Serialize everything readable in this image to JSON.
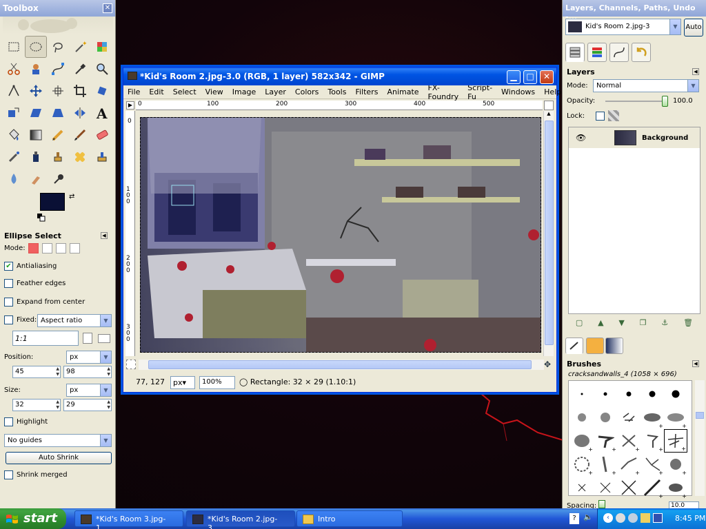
{
  "toolbox": {
    "title": "Toolbox",
    "tools": [
      "rect-select",
      "ellipse-select",
      "free-select",
      "fuzzy-select",
      "select-by-color",
      "scissors",
      "foreground-select",
      "paths",
      "color-picker",
      "zoom",
      "measure",
      "move",
      "align",
      "crop",
      "rotate",
      "scale",
      "shear",
      "perspective",
      "flip",
      "text",
      "bucket-fill",
      "blend",
      "pencil",
      "paintbrush",
      "eraser",
      "airbrush",
      "ink",
      "clone",
      "heal",
      "perspective-clone",
      "blur-sharpen",
      "smudge",
      "dodge-burn"
    ],
    "fg_color": "#0a1035",
    "bg_color": "#ffffff"
  },
  "tool_options": {
    "title": "Ellipse Select",
    "mode_label": "Mode:",
    "antialiasing_label": "Antialiasing",
    "feather_label": "Feather edges",
    "expand_label": "Expand from center",
    "fixed_label": "Fixed:",
    "fixed_value": "Aspect ratio",
    "ratio_value": "1:1",
    "position_label": "Position:",
    "position_unit": "px",
    "pos_x": "45",
    "pos_y": "98",
    "size_label": "Size:",
    "size_unit": "px",
    "size_w": "32",
    "size_h": "29",
    "highlight_label": "Highlight",
    "guides_value": "No guides",
    "autoshrink_label": "Auto Shrink",
    "shrink_merged_label": "Shrink merged"
  },
  "image_window": {
    "title": "*Kid's Room 2.jpg-3.0 (RGB, 1 layer) 582x342 - GIMP",
    "menus": [
      "File",
      "Edit",
      "Select",
      "View",
      "Image",
      "Layer",
      "Colors",
      "Tools",
      "Filters",
      "Animate",
      "FX-Foundry",
      "Script-Fu",
      "Windows",
      "Help"
    ],
    "ruler_top": [
      "0",
      "100",
      "200",
      "300",
      "400",
      "500"
    ],
    "ruler_left": [
      "0",
      "100",
      "200",
      "300"
    ],
    "coords": "77, 127",
    "unit": "px",
    "zoom": "100%",
    "status": "Rectangle: 32 × 29  (1.10:1)"
  },
  "layers_dock": {
    "title": "Layers, Channels, Paths, Undo -...",
    "image_select": "Kid's Room 2.jpg-3",
    "auto_label": "Auto",
    "panel_title": "Layers",
    "mode_label": "Mode:",
    "mode_value": "Normal",
    "opacity_label": "Opacity:",
    "opacity_value": "100.0",
    "lock_label": "Lock:",
    "layer_name": "Background"
  },
  "brushes": {
    "title": "Brushes",
    "current": "cracksandwalls_4 (1058 × 696)",
    "spacing_label": "Spacing:",
    "spacing_value": "10.0"
  },
  "taskbar": {
    "start_label": "start",
    "tasks": [
      "*Kid's Room 3.jpg-1....",
      "*Kid's Room 2.jpg-3....",
      "Intro"
    ],
    "clock": "8:45 PM"
  }
}
